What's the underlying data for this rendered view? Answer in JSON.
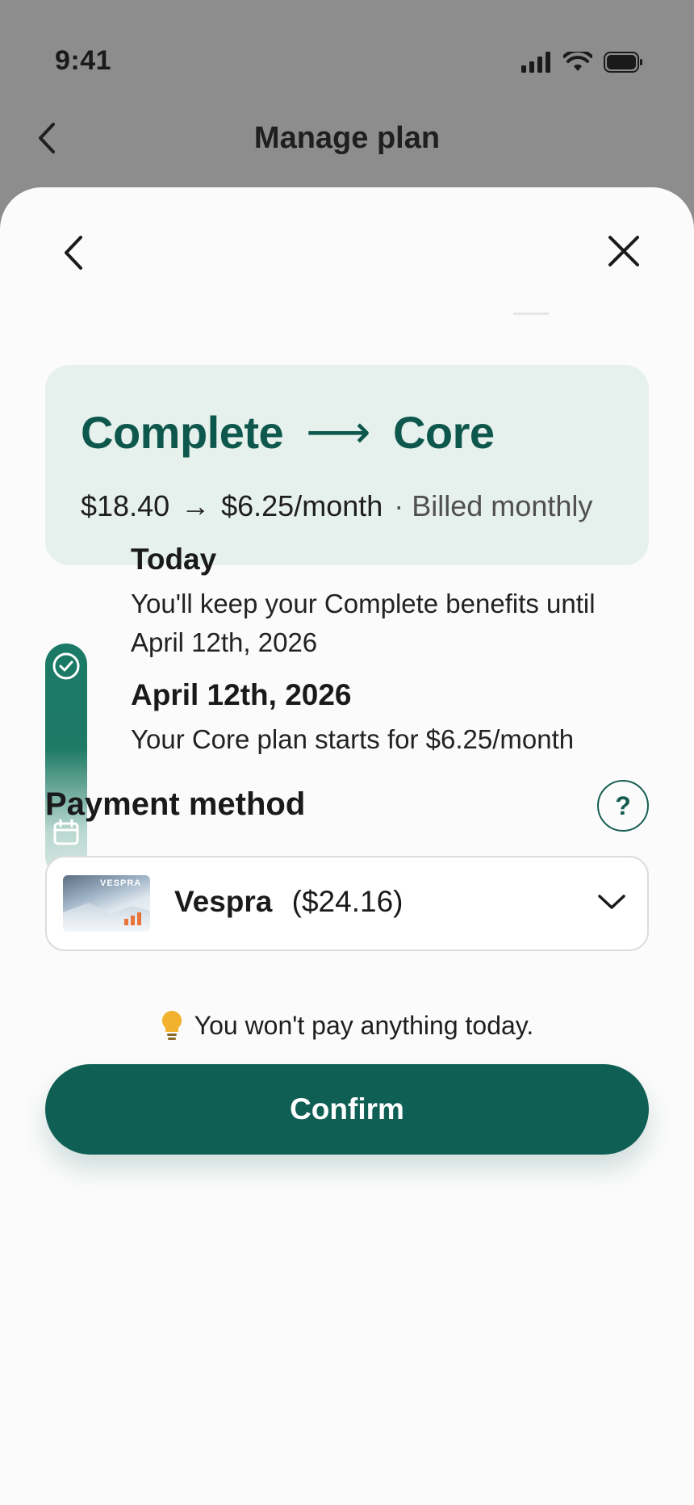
{
  "status_bar": {
    "time": "9:41"
  },
  "background_header": {
    "title": "Manage plan"
  },
  "plan_change": {
    "from_plan": "Complete",
    "arrow": "⟶",
    "to_plan": "Core",
    "from_price": "$18.40",
    "price_arrow": "→",
    "to_price": "$6.25/month",
    "billing": "· Billed monthly"
  },
  "timeline": [
    {
      "title": "Today",
      "text": "You'll keep your Complete benefits until April 12th, 2026"
    },
    {
      "title": "April 12th, 2026",
      "text": "Your Core plan starts for $6.25/month"
    }
  ],
  "payment": {
    "title": "Payment method",
    "help_label": "?",
    "card_brand_text": "VESPRA",
    "card_name": "Vespra",
    "card_balance": "($24.16)"
  },
  "notice": {
    "icon": "lightbulb-icon",
    "text": "You won't pay anything today."
  },
  "confirm_label": "Confirm",
  "colors": {
    "accent": "#0f5f55",
    "card_bg": "#e6f0ec",
    "title_green": "#0e574c"
  }
}
